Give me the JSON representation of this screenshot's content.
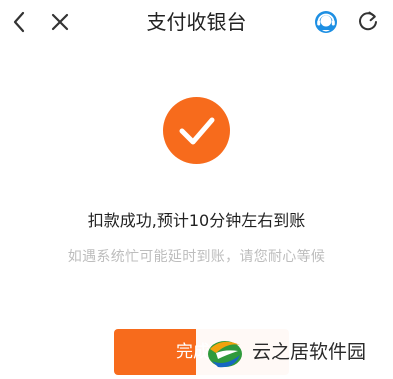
{
  "header": {
    "title": "支付收银台",
    "back_icon": "chevron-left-icon",
    "close_icon": "close-icon",
    "service_icon": "customer-service-icon",
    "refresh_icon": "refresh-icon"
  },
  "result": {
    "status_icon": "checkmark-icon",
    "title": "扣款成功,预计10分钟左右到账",
    "hint": "如遇系统忙可能延时到账，请您耐心等候"
  },
  "actions": {
    "done_label": "完成"
  },
  "watermark": {
    "text": "云之居软件园"
  },
  "colors": {
    "accent": "#f76b1c",
    "service_blue": "#1d8fe3",
    "title_text": "#222222",
    "hint_text": "#bdbdbd"
  }
}
